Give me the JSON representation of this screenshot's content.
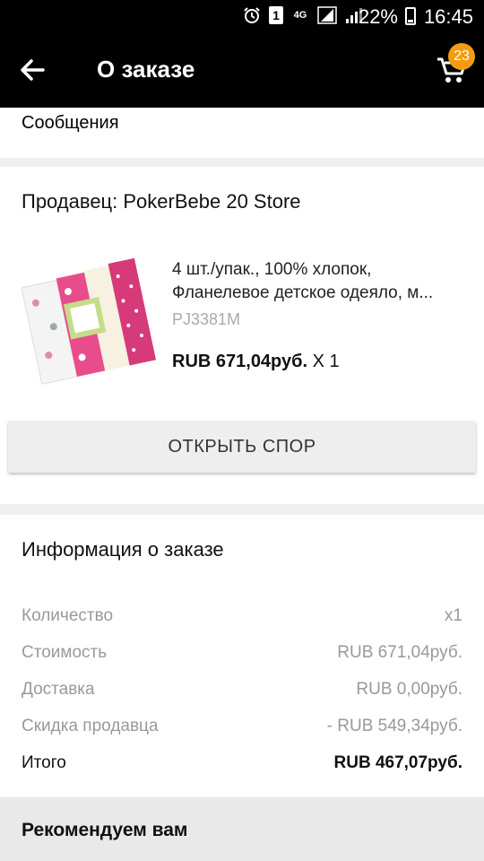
{
  "status_bar": {
    "network": "4G",
    "sim": "1",
    "battery": "22%",
    "time": "16:45"
  },
  "app_bar": {
    "title": "О заказе",
    "cart_count": "23"
  },
  "messages": {
    "label": "Сообщения"
  },
  "seller": {
    "label": "Продавец: PokerBebe 20 Store"
  },
  "product": {
    "title_line1": "4 шт./упак., 100% хлопок,",
    "title_line2": "Фланелевое детское одеяло, м...",
    "sku": "PJ3381M",
    "price": "RUB 671,04руб.",
    "qty": " X 1"
  },
  "dispute_button": "ОТКРЫТЬ СПОР",
  "order_info": {
    "title": "Информация о заказе",
    "rows": [
      {
        "label": "Количество",
        "value": "x1"
      },
      {
        "label": "Стоимость",
        "value": "RUB 671,04руб."
      },
      {
        "label": "Доставка",
        "value": "RUB 0,00руб."
      },
      {
        "label": "Скидка продавца",
        "value": "- RUB 549,34руб."
      },
      {
        "label": "Итого",
        "value": "RUB 467,07руб."
      }
    ]
  },
  "recommend": {
    "label": "Рекомендуем вам"
  },
  "colors": {
    "badge": "#f39c12",
    "bar": "#000000"
  }
}
